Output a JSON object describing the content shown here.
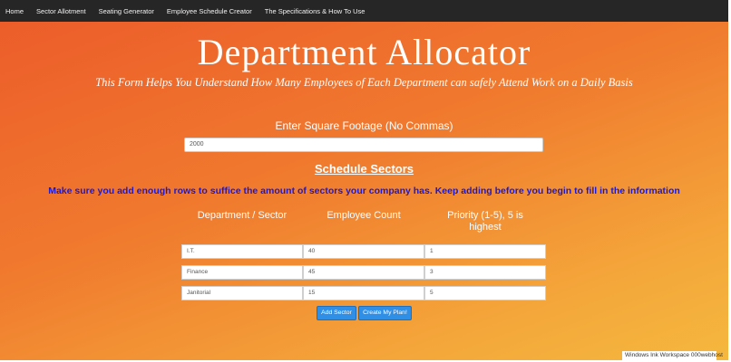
{
  "nav": {
    "items": [
      "Home",
      "Sector Allotment",
      "Seating Generator",
      "Employee Schedule Creator",
      "The Specifications & How To Use"
    ]
  },
  "header": {
    "title": "Department Allocator",
    "subtitle": "This Form Helps You Understand How Many Employees of Each Department can safely Attend Work on a Daily Basis"
  },
  "sqft": {
    "label": "Enter Square Footage (No Commas)",
    "value": "2000"
  },
  "schedule": {
    "heading": "Schedule Sectors",
    "warning": "Make sure you add enough rows to suffice the amount of sectors your company has. Keep adding before you begin to fill in the information",
    "columns": [
      "Department / Sector",
      "Employee Count",
      "Priority (1-5), 5 is highest"
    ],
    "rows": [
      {
        "dept": "I.T.",
        "count": "40",
        "priority": "1"
      },
      {
        "dept": "Finance",
        "count": "45",
        "priority": "3"
      },
      {
        "dept": "Janitorial",
        "count": "15",
        "priority": "5"
      }
    ]
  },
  "buttons": {
    "add": "Add Sector",
    "create": "Create My Plan!"
  },
  "overlay": {
    "badge": "Windows Ink Workspace 000webhost"
  },
  "colors": {
    "navbar": "#262626",
    "warning_text": "#1a1ad6",
    "button": "#2f8fe6"
  }
}
